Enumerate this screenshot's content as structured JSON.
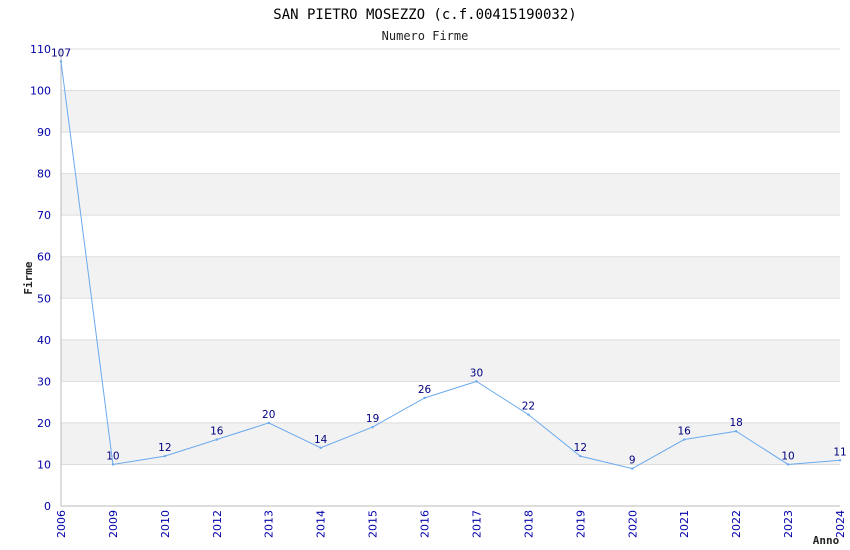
{
  "chart_data": {
    "type": "line",
    "title": "SAN PIETRO MOSEZZO (c.f.00415190032)",
    "subtitle": "Numero Firme",
    "xlabel": "Anno",
    "ylabel": "Firme",
    "ylim": [
      0,
      110
    ],
    "yticks": [
      "0",
      "10",
      "20",
      "30",
      "40",
      "50",
      "60",
      "70",
      "80",
      "90",
      "100",
      "110"
    ],
    "categories": [
      "2006",
      "2009",
      "2010",
      "2012",
      "2013",
      "2014",
      "2015",
      "2016",
      "2017",
      "2018",
      "2019",
      "2020",
      "2021",
      "2022",
      "2023",
      "2024"
    ],
    "values": [
      107,
      10,
      12,
      16,
      20,
      14,
      19,
      26,
      30,
      22,
      12,
      9,
      16,
      18,
      10,
      11
    ],
    "data_labels": [
      "107",
      "10",
      "12",
      "16",
      "20",
      "14",
      "19",
      "26",
      "30",
      "22",
      "12",
      "9",
      "16",
      "18",
      "10",
      "11"
    ],
    "grid": "horizontal alternating bands",
    "colors": {
      "line": "#6aa9ee",
      "band": "#f2f2f2",
      "gridline": "#dddddd",
      "tick_text": "#0000aa",
      "label_text": "#000080"
    }
  }
}
